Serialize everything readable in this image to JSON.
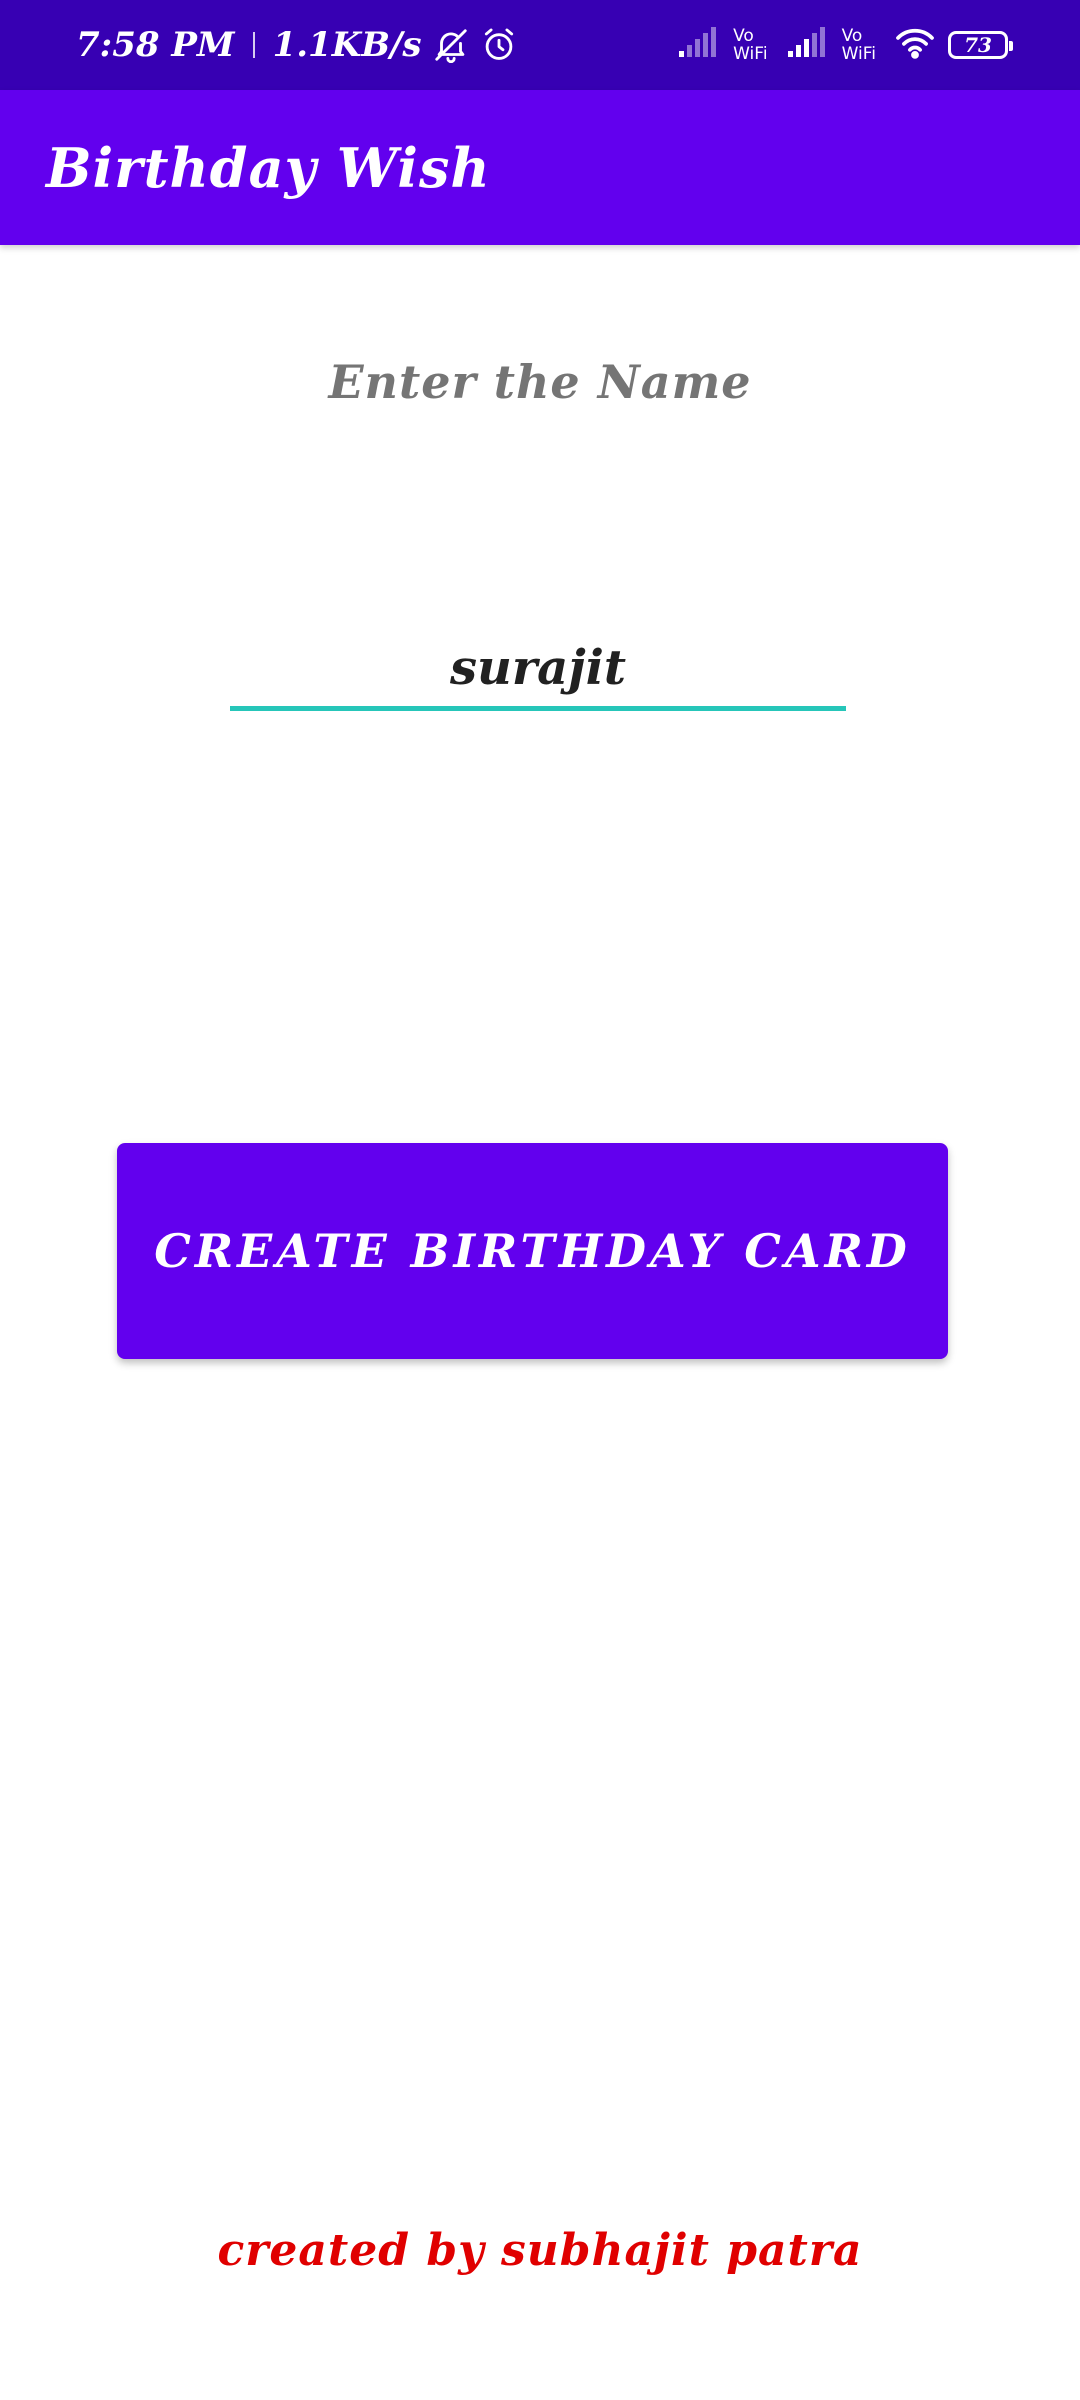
{
  "status_bar": {
    "time": "7:58 PM",
    "network_speed": "1.1KB/s",
    "icons": [
      "bell-muted-icon",
      "alarm-icon",
      "signal-icon",
      "vowifi-icon",
      "signal-icon",
      "vowifi-icon",
      "wifi-icon",
      "battery-icon"
    ],
    "vowifi_top": "Vo",
    "vowifi_bottom": "WiFi",
    "battery_level": "73"
  },
  "app_bar": {
    "title": "Birthday Wish"
  },
  "main": {
    "prompt_label": "Enter the Name",
    "name_input_value": "surajit",
    "create_button_label": "CREATE BIRTHDAY CARD"
  },
  "footer": {
    "credit": "created by subhajit patra"
  },
  "colors": {
    "status_bar": "#3700b3",
    "primary": "#6200ee",
    "input_underline": "#26c6b9",
    "footer_text": "#e00000",
    "label_text": "#757575"
  }
}
